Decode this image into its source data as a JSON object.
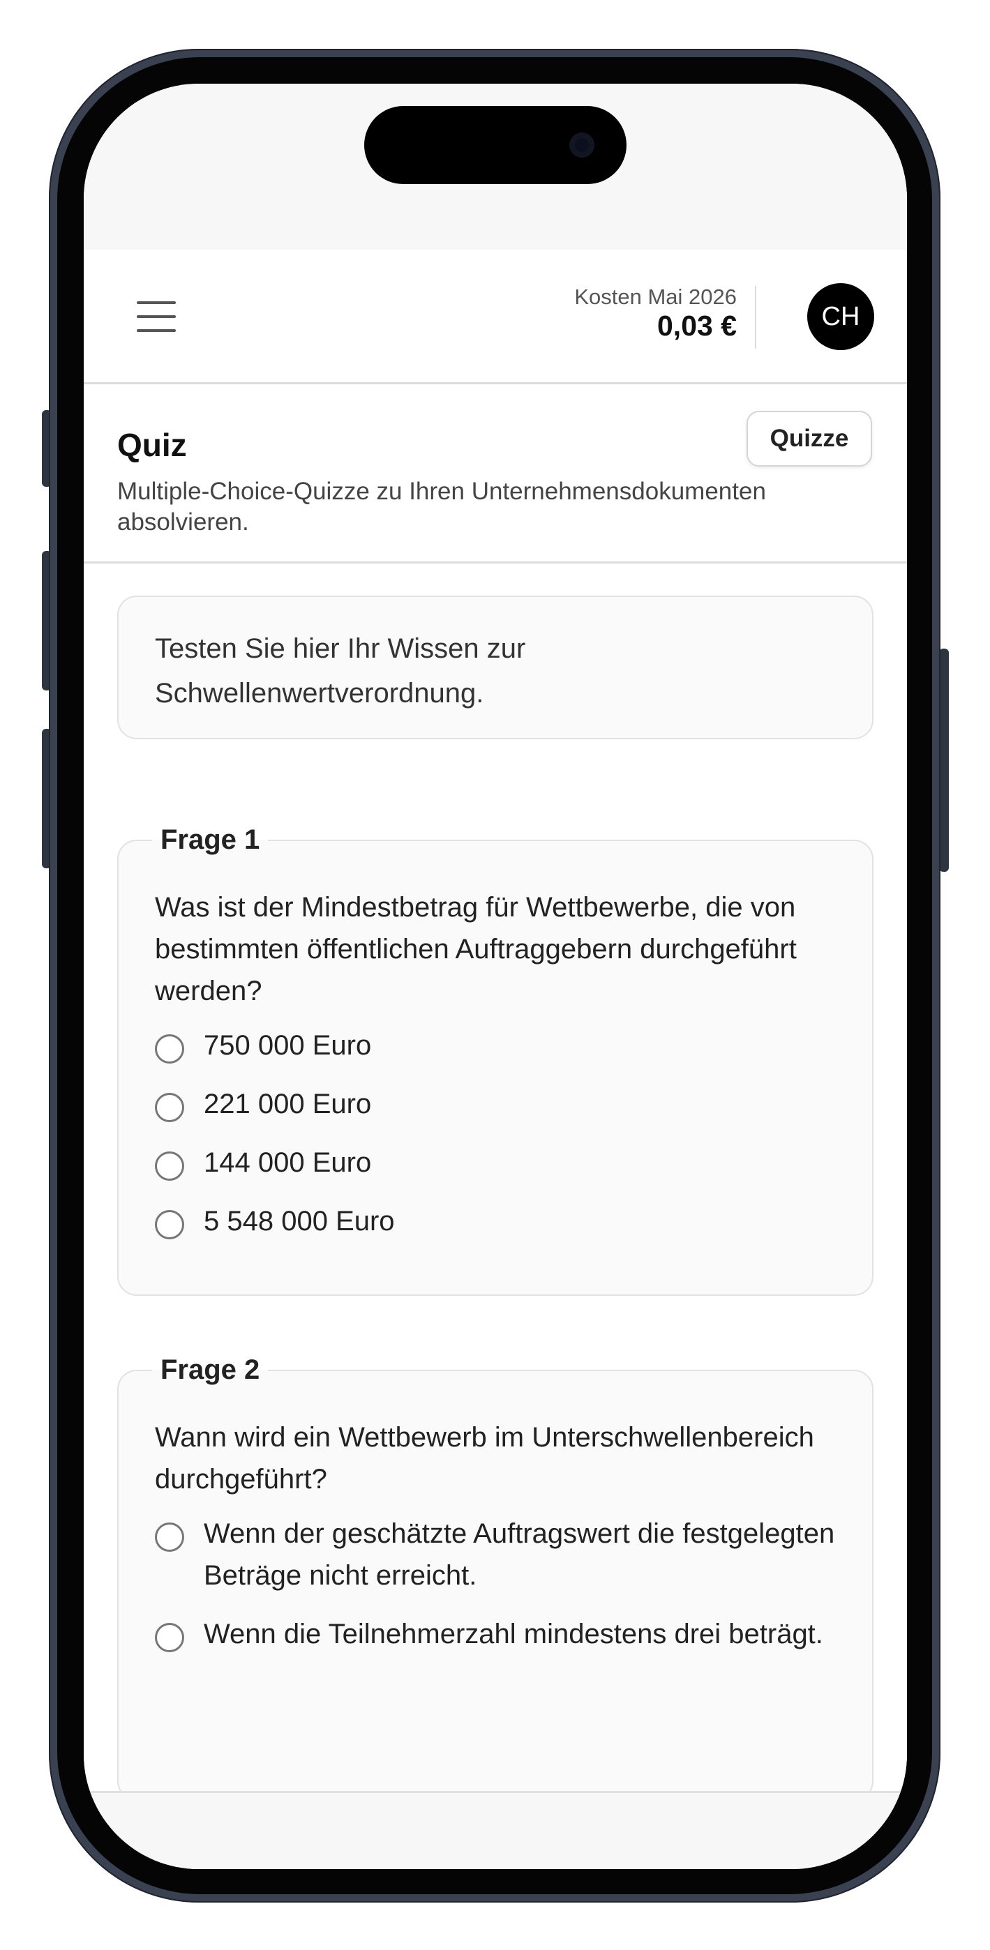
{
  "header": {
    "cost_label": "Kosten Mai 2026",
    "cost_value": "0,03 €",
    "avatar_initials": "CH"
  },
  "page": {
    "title": "Quiz",
    "subtitle": "Multiple-Choice-Quizze zu Ihren Unternehmensdokumenten absolvieren.",
    "quizze_button": "Quizze"
  },
  "intro": "Testen Sie hier Ihr Wissen zur Schwellenwertverordnung.",
  "questions": [
    {
      "legend": "Frage 1",
      "text": "Was ist der Mindestbetrag für Wettbewerbe, die von bestimmten öffentlichen Auftraggebern durchgeführt werden?",
      "options": [
        "750 000 Euro",
        "221 000 Euro",
        "144 000 Euro",
        "5 548 000 Euro"
      ]
    },
    {
      "legend": "Frage 2",
      "text": "Wann wird ein Wettbewerb im Unterschwellenbereich durchgeführt?",
      "options": [
        "Wenn der geschätzte Auftragswert die festgelegten Beträge nicht erreicht.",
        "Wenn die Teilnehmerzahl mindestens drei beträgt."
      ]
    }
  ]
}
